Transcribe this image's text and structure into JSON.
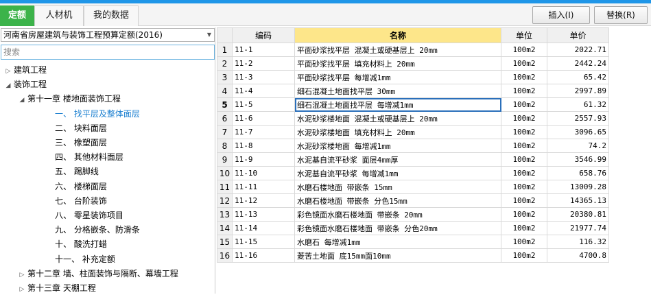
{
  "tabs": [
    {
      "label": "定额",
      "active": true
    },
    {
      "label": "人材机",
      "active": false
    },
    {
      "label": "我的数据",
      "active": false
    }
  ],
  "toolbar": {
    "insert_label": "插入(I)",
    "replace_label": "替换(R)"
  },
  "left": {
    "library": "河南省房屋建筑与装饰工程预算定额(2016)",
    "search_placeholder": "搜索",
    "tree": [
      {
        "label": "建筑工程",
        "level": 0,
        "expander": "▷"
      },
      {
        "label": "装饰工程",
        "level": 0,
        "expander": "◢"
      },
      {
        "label": "第十一章  楼地面装饰工程",
        "level": 1,
        "expander": "◢"
      },
      {
        "label": "一、  找平层及整体面层",
        "level": 2,
        "expander": "",
        "selected": true
      },
      {
        "label": "二、  块料面层",
        "level": 2,
        "expander": ""
      },
      {
        "label": "三、  橡塑面层",
        "level": 2,
        "expander": ""
      },
      {
        "label": "四、  其他材料面层",
        "level": 2,
        "expander": ""
      },
      {
        "label": "五、  踢脚线",
        "level": 2,
        "expander": ""
      },
      {
        "label": "六、  楼梯面层",
        "level": 2,
        "expander": ""
      },
      {
        "label": "七、  台阶装饰",
        "level": 2,
        "expander": ""
      },
      {
        "label": "八、  零星装饰项目",
        "level": 2,
        "expander": ""
      },
      {
        "label": "九、  分格嵌条、防滑条",
        "level": 2,
        "expander": ""
      },
      {
        "label": "十、  酸洗打蜡",
        "level": 2,
        "expander": ""
      },
      {
        "label": "十一、  补充定额",
        "level": 2,
        "expander": ""
      },
      {
        "label": "第十二章  墙、柱面装饰与隔断、幕墙工程",
        "level": 1,
        "expander": "▷"
      },
      {
        "label": "第十三章  天棚工程",
        "level": 1,
        "expander": "▷"
      }
    ]
  },
  "table": {
    "headers": {
      "code": "编码",
      "name": "名称",
      "unit": "单位",
      "price": "单价"
    },
    "selected_row": 5,
    "rows": [
      {
        "idx": "1",
        "code": "11-1",
        "name": "平面砂浆找平层 混凝土或硬基层上 20mm",
        "unit": "100m2",
        "price": "2022.71"
      },
      {
        "idx": "2",
        "code": "11-2",
        "name": "平面砂浆找平层 填充材料上 20mm",
        "unit": "100m2",
        "price": "2442.24"
      },
      {
        "idx": "3",
        "code": "11-3",
        "name": "平面砂浆找平层 每增减1mm",
        "unit": "100m2",
        "price": "65.42"
      },
      {
        "idx": "4",
        "code": "11-4",
        "name": "细石混凝土地面找平层 30mm",
        "unit": "100m2",
        "price": "2997.89"
      },
      {
        "idx": "5",
        "code": "11-5",
        "name": "细石混凝土地面找平层 每增减1mm",
        "unit": "100m2",
        "price": "61.32"
      },
      {
        "idx": "6",
        "code": "11-6",
        "name": "水泥砂浆楼地面 混凝土或硬基层上 20mm",
        "unit": "100m2",
        "price": "2557.93"
      },
      {
        "idx": "7",
        "code": "11-7",
        "name": "水泥砂浆楼地面 填充材料上 20mm",
        "unit": "100m2",
        "price": "3096.65"
      },
      {
        "idx": "8",
        "code": "11-8",
        "name": "水泥砂浆楼地面 每增减1mm",
        "unit": "100m2",
        "price": "74.2"
      },
      {
        "idx": "9",
        "code": "11-9",
        "name": "水泥基自流平砂浆 面层4mm厚",
        "unit": "100m2",
        "price": "3546.99"
      },
      {
        "idx": "10",
        "code": "11-10",
        "name": "水泥基自流平砂浆 每增减1mm",
        "unit": "100m2",
        "price": "658.76"
      },
      {
        "idx": "11",
        "code": "11-11",
        "name": "水磨石楼地面 带嵌条 15mm",
        "unit": "100m2",
        "price": "13009.28"
      },
      {
        "idx": "12",
        "code": "11-12",
        "name": "水磨石楼地面 带嵌条 分色15mm",
        "unit": "100m2",
        "price": "14365.13"
      },
      {
        "idx": "13",
        "code": "11-13",
        "name": "彩色镜面水磨石楼地面 带嵌条 20mm",
        "unit": "100m2",
        "price": "20380.81"
      },
      {
        "idx": "14",
        "code": "11-14",
        "name": "彩色镜面水磨石楼地面 带嵌条 分色20mm",
        "unit": "100m2",
        "price": "21977.74"
      },
      {
        "idx": "15",
        "code": "11-15",
        "name": "水磨石 每增减1mm",
        "unit": "100m2",
        "price": "116.32"
      },
      {
        "idx": "16",
        "code": "11-16",
        "name": "菱苦土地面 底15mm面10mm",
        "unit": "100m2",
        "price": "4700.8"
      }
    ]
  },
  "colors": {
    "accent_tab": "#3cb34a",
    "top_strip": "#1f96e8",
    "name_header": "#fde68a",
    "selected_tree": "#1a7fd0"
  }
}
